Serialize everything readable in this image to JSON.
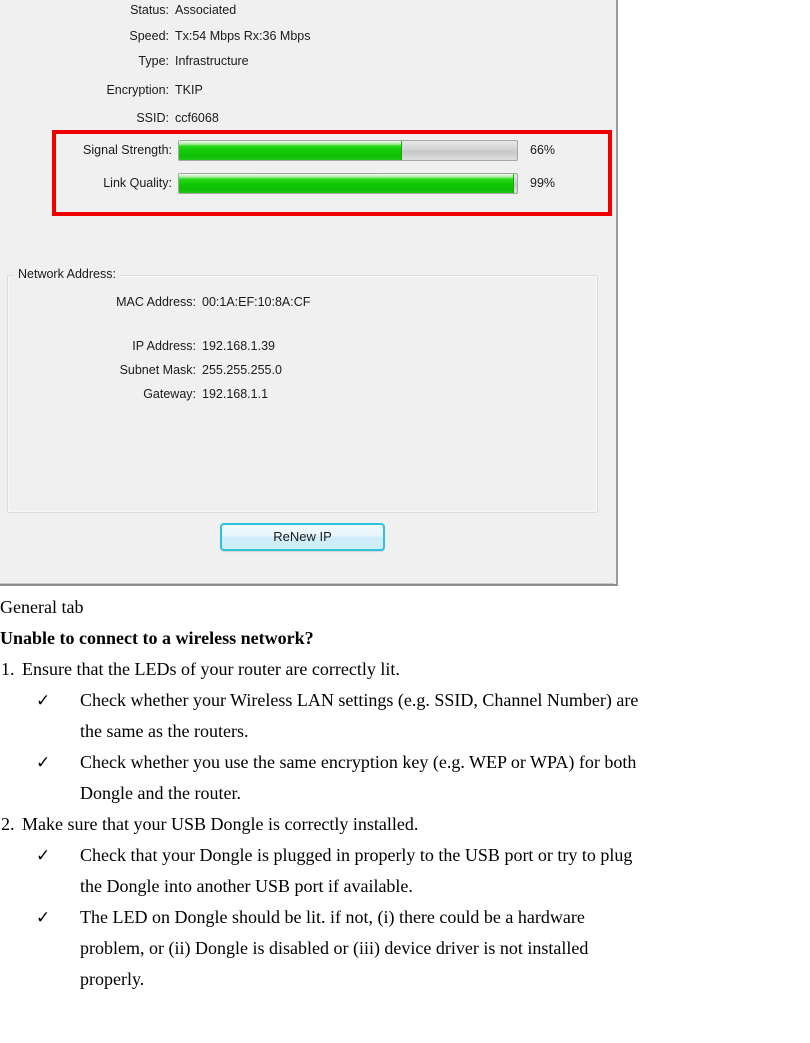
{
  "dialog": {
    "info_rows": [
      {
        "label": "Status:",
        "value": "Associated"
      },
      {
        "label": "Speed:",
        "value": "Tx:54 Mbps Rx:36 Mbps"
      },
      {
        "label": "Type:",
        "value": "Infrastructure"
      },
      {
        "label": "Encryption:",
        "value": "TKIP"
      },
      {
        "label": "SSID:",
        "value": "ccf6068"
      }
    ],
    "metrics": [
      {
        "label": "Signal Strength:",
        "percent_text": "66%",
        "percent": 66
      },
      {
        "label": "Link Quality:",
        "percent_text": "99%",
        "percent": 99
      }
    ],
    "network_group": {
      "legend": "Network Address:",
      "rows": [
        {
          "label": "MAC Address:",
          "value": "00:1A:EF:10:8A:CF"
        },
        {
          "label": "IP Address:",
          "value": "192.168.1.39"
        },
        {
          "label": "Subnet Mask:",
          "value": "255.255.255.0"
        },
        {
          "label": "Gateway:",
          "value": "192.168.1.1"
        }
      ]
    },
    "renew_button_label": "ReNew IP",
    "highlight_color": "#f10000",
    "bar_fill_color": "#12c806",
    "bar_track_color": "#d2d2d2",
    "button_border_color": "#2ec2dd"
  },
  "document": {
    "caption": "General tab",
    "heading": "Unable to connect to a wireless network?",
    "items": [
      {
        "number": "1.",
        "text": "Ensure that the LEDs of your router are correctly lit.",
        "checks": [
          {
            "mark": "✓",
            "lines": [
              "Check whether your Wireless LAN settings (e.g. SSID, Channel Number) are",
              "the same as the routers."
            ]
          },
          {
            "mark": "✓",
            "lines": [
              "Check whether you use the same encryption key (e.g. WEP or WPA) for both",
              "Dongle and the router."
            ]
          }
        ]
      },
      {
        "number": "2.",
        "text": "Make sure that your USB Dongle is correctly installed.",
        "checks": [
          {
            "mark": "✓",
            "lines": [
              "Check that your Dongle is plugged in properly to the USB port or try to plug",
              "the Dongle into another USB port if available."
            ]
          },
          {
            "mark": "✓",
            "lines": [
              "The LED on Dongle should be lit. if not, (i) there could be a hardware",
              "problem, or (ii) Dongle is disabled or (iii) device driver is not installed",
              "properly."
            ]
          }
        ]
      }
    ]
  }
}
